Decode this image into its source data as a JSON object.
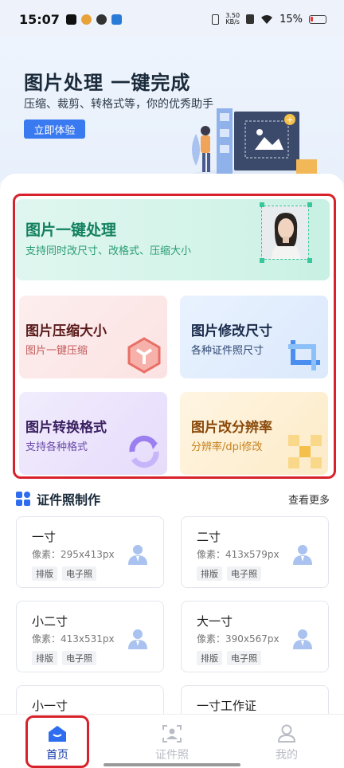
{
  "status_bar": {
    "time": "15:07",
    "net_speed_value": "3.50",
    "net_speed_unit": "KB/s",
    "battery": "15%",
    "icons": [
      "tiktok-icon",
      "weibo-icon",
      "app-icon",
      "app-icon",
      "vibrate-icon",
      "sim-icon",
      "wifi-icon",
      "battery-icon"
    ]
  },
  "hero": {
    "title": "图片处理 一键完成",
    "subtitle": "压缩、裁剪、转格式等，你的优秀助手",
    "cta": "立即体验"
  },
  "features": {
    "main": {
      "title": "图片一键处理",
      "subtitle": "支持同时改尺寸、改格式、压缩大小"
    },
    "compress": {
      "title": "图片压缩大小",
      "subtitle": "图片一键压缩"
    },
    "resize": {
      "title": "图片修改尺寸",
      "subtitle": "各种证件照尺寸"
    },
    "format": {
      "title": "图片转换格式",
      "subtitle": "支持各种格式"
    },
    "resolution": {
      "title": "图片改分辨率",
      "subtitle": "分辨率/dpi修改"
    }
  },
  "id_section": {
    "title": "证件照制作",
    "more": "查看更多",
    "cards": [
      {
        "name": "一寸",
        "pixels": "像素：295x413px",
        "tags": [
          "排版",
          "电子照"
        ]
      },
      {
        "name": "二寸",
        "pixels": "像素：413x579px",
        "tags": [
          "排版",
          "电子照"
        ]
      },
      {
        "name": "小二寸",
        "pixels": "像素：413x531px",
        "tags": [
          "排版",
          "电子照"
        ]
      },
      {
        "name": "大一寸",
        "pixels": "像素：390x567px",
        "tags": [
          "排版",
          "电子照"
        ]
      },
      {
        "name": "小一寸",
        "pixels": "",
        "tags": []
      },
      {
        "name": "一寸工作证",
        "pixels": "",
        "tags": []
      }
    ]
  },
  "bottom_nav": [
    {
      "label": "首页",
      "icon": "home-icon",
      "active": true
    },
    {
      "label": "证件照",
      "icon": "id-photo-icon",
      "active": false
    },
    {
      "label": "我的",
      "icon": "profile-icon",
      "active": false
    }
  ],
  "colors": {
    "accent": "#3a7af0",
    "highlight": "#d8222b",
    "main_card_text": "#12805c"
  }
}
